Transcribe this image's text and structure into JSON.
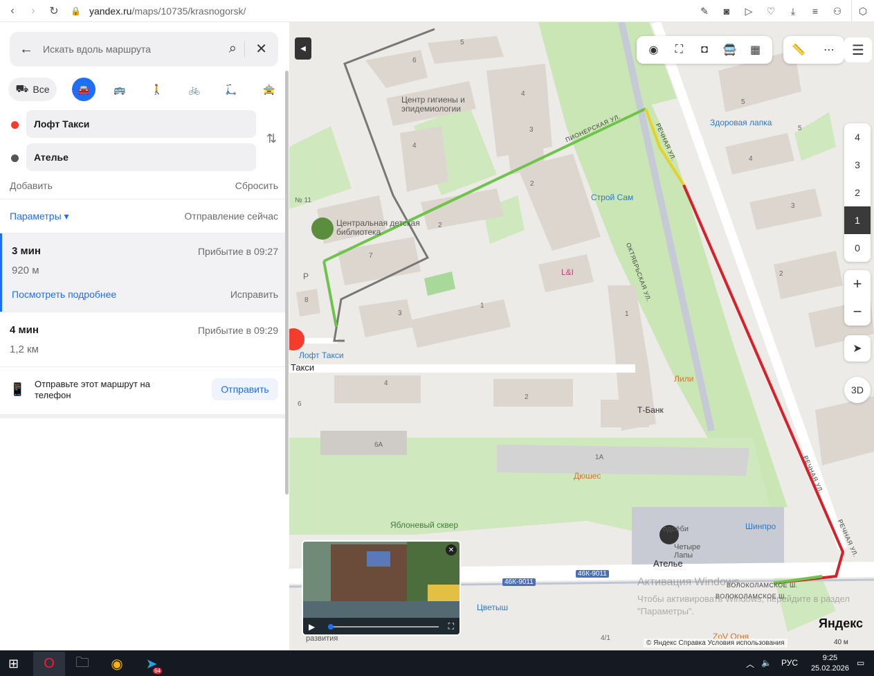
{
  "browser": {
    "url_host": "yandex.ru",
    "url_path": "/maps/10735/krasnogorsk/"
  },
  "sidebar": {
    "search_placeholder": "Искать вдоль маршрута",
    "modes": {
      "all_label": "Все"
    },
    "from": "Лофт Такси",
    "to": "Ателье",
    "add_label": "Добавить",
    "reset_label": "Сбросить",
    "params_label": "Параметры ▾",
    "depart_label": "Отправление сейчас",
    "routes": [
      {
        "time": "3 мин",
        "distance": "920 м",
        "arrival": "Прибытие в 09:27",
        "details": "Посмотреть подробнее",
        "fix": "Исправить"
      },
      {
        "time": "4 мин",
        "distance": "1,2 км",
        "arrival": "Прибытие в 09:29"
      }
    ],
    "send_text": "Отправьте этот маршрут на телефон",
    "send_button": "Отправить"
  },
  "map": {
    "floors": [
      "4",
      "3",
      "2",
      "1",
      "0"
    ],
    "active_floor": "1",
    "btn_3d": "3D",
    "labels": {
      "hygiene_center": "Центр гигиены и эпидемиологии",
      "library": "Центральная детская библиотека",
      "stroy_sam": "Строй Сам",
      "zdorovaya_lapka": "Здоровая лапка",
      "li": "L&I",
      "loft_taxi": "Лофт Такси",
      "taksi_frag": "Такси",
      "lili": "Лили",
      "tbank": "Т-Банк",
      "dyushes": "Дюшес",
      "yablonevy": "Яблоневый сквер",
      "shinpro": "Шинпро",
      "chetyre_lapy": "Четыре Лапы",
      "atelie": "Ателье",
      "tsvetysh": "Цветыш",
      "zov_ognya": "ZoV Огня",
      "razvitiya": "развития",
      "podoshvy": "одоёби",
      "pionerskaya": "ПИОНЕРСКАЯ УЛ.",
      "rechnaya1": "РЕЧНАЯ УЛ.",
      "rechnaya2": "РЕЧНАЯ УЛ.",
      "rechnaya3": "РЕЧНАЯ УЛ.",
      "oktyabrskaya": "ОКТЯБРЬСКАЯ УЛ.",
      "volokolamskoe1": "ВОЛОКОЛАМСКОЕ Ш.",
      "volokolamskoe2": "ВОЛОКОЛАМСКОЕ Ш.",
      "road1": "46К-9011",
      "road2": "46К-9011",
      "num_11": "№ 11",
      "p": "Р"
    },
    "house_numbers": [
      "5",
      "6",
      "4",
      "3",
      "5",
      "4",
      "4",
      "2",
      "3",
      "2",
      "7",
      "2",
      "8",
      "3",
      "1",
      "1",
      "4",
      "2",
      "6",
      "6А",
      "1А",
      "4/1",
      "5"
    ],
    "activate_title": "Активация Windows",
    "activate_sub": "Чтобы активировать Windows, перейдите в раздел \"Параметры\".",
    "logo": "Яндекс",
    "footer": "© Яндекс   Справка   Условия использования",
    "scale": "40 м"
  },
  "taskbar": {
    "lang": "РУС",
    "time": "9:25",
    "date": "25.02.2026",
    "badge": "64"
  }
}
